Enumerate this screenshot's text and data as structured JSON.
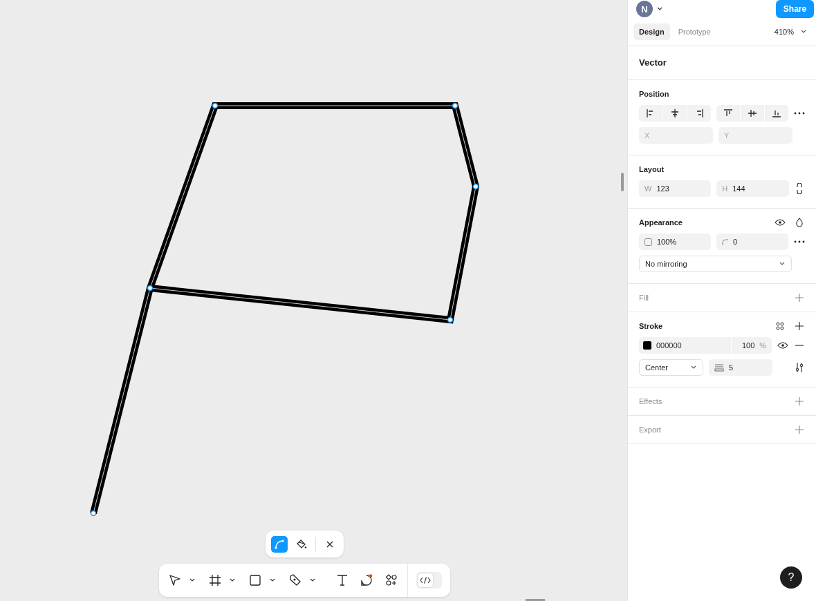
{
  "user": {
    "initial": "N"
  },
  "share_button": "Share",
  "tabs": [
    {
      "label": "Design",
      "selected": true
    },
    {
      "label": "Prototype",
      "selected": false
    }
  ],
  "zoom": "410%",
  "selection": {
    "title": "Vector"
  },
  "position": {
    "title": "Position",
    "x": {
      "placeholder": "X"
    },
    "y": {
      "placeholder": "Y"
    }
  },
  "layout": {
    "title": "Layout",
    "w": {
      "label": "W",
      "value": "123"
    },
    "h": {
      "label": "H",
      "value": "144"
    }
  },
  "appearance": {
    "title": "Appearance",
    "opacity": "100%",
    "corner_radius": "0",
    "mirroring": "No mirroring"
  },
  "fill": {
    "title": "Fill",
    "active": false
  },
  "stroke": {
    "title": "Stroke",
    "active": true,
    "color": "#000000",
    "hex": "000000",
    "opacity": "100",
    "unit": "%",
    "align": "Center",
    "weight": "5"
  },
  "effects": {
    "title": "Effects",
    "active": false
  },
  "export": {
    "title": "Export",
    "active": false
  },
  "edit_toolbar": [
    {
      "kind": "bend",
      "selected": true
    },
    {
      "kind": "paint",
      "selected": false
    },
    {
      "kind": "close",
      "selected": false
    }
  ],
  "dev_mode": {
    "on": false
  },
  "help": "?"
}
